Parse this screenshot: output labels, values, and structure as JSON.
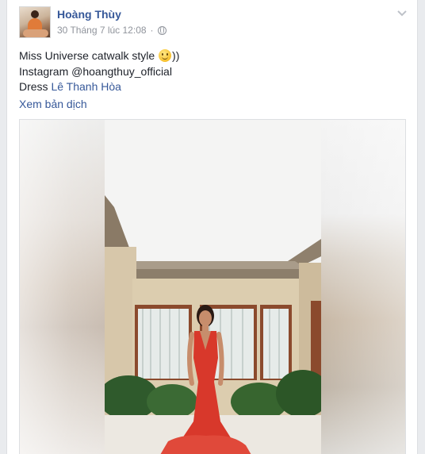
{
  "post": {
    "author_name": "Hoàng Thùy",
    "timestamp": "30 Tháng 7 lúc 12:08",
    "audience_icon": "globe-icon",
    "options_icon": "chevron-down-icon",
    "text": {
      "line1": "Miss Universe catwalk style",
      "line1_suffix": "))",
      "emoji": "smile-icon",
      "line2": "Instagram @hoangthuy_official",
      "line3_prefix": "Dress ",
      "line3_link": "Lê Thanh Hòa"
    },
    "see_translation": "Xem bản dịch"
  },
  "colors": {
    "link": "#365899",
    "text": "#1d2129",
    "meta": "#90949c",
    "dress": "#d8382b"
  }
}
